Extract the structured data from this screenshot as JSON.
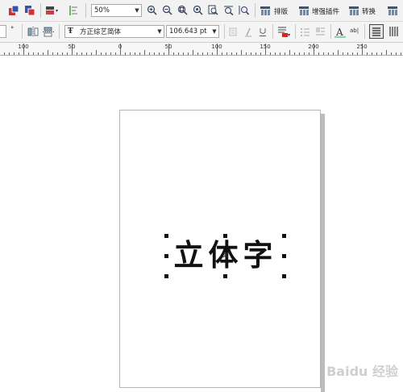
{
  "toolbar": {
    "zoom_value": "50%",
    "menus": [
      {
        "label": "排版"
      },
      {
        "label": "增强插件"
      },
      {
        "label": "转换"
      }
    ]
  },
  "propertybar": {
    "degree_symbol": "°",
    "font_name": "方正综艺简体",
    "font_size": "106.643 pt",
    "text_type_glyph": "A",
    "ab_glyph": "ab|"
  },
  "ruler": {
    "marks": [
      "100",
      "50",
      "0",
      "50",
      "100",
      "150",
      "200",
      "250"
    ]
  },
  "document": {
    "art_text": "立体字"
  },
  "watermark": {
    "text": "Baidu 经验"
  },
  "colors": {
    "toolbar_bg": "#f2f2f2",
    "canvas_bg": "#ffffff",
    "page_border": "#b5b5b5",
    "selected_view": "#1a1a1a",
    "text_color": "#111111"
  }
}
